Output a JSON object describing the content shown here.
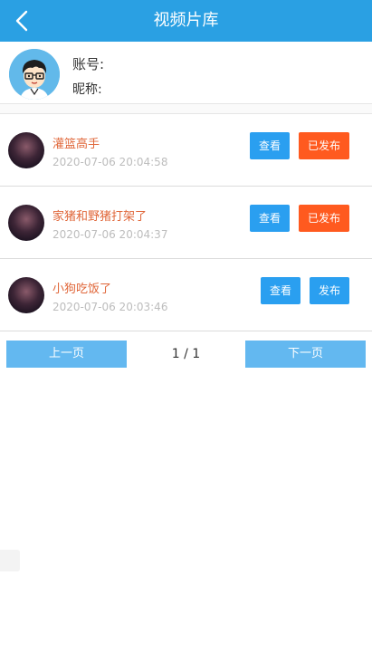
{
  "header": {
    "title": "视频片库",
    "back_icon": "chevron-left-icon"
  },
  "profile": {
    "account_label": "账号:",
    "account_value": "",
    "nickname_label": "昵称:",
    "nickname_value": ""
  },
  "videos": [
    {
      "title": "灌篮高手",
      "time": "2020-07-06 20:04:58",
      "view_label": "查看",
      "publish_label": "已发布",
      "published": true
    },
    {
      "title": "家猪和野猪打架了",
      "time": "2020-07-06 20:04:37",
      "view_label": "查看",
      "publish_label": "已发布",
      "published": true
    },
    {
      "title": "小狗吃饭了",
      "time": "2020-07-06 20:03:46",
      "view_label": "查看",
      "publish_label": "发布",
      "published": false
    }
  ],
  "pagination": {
    "prev_label": "上一页",
    "page_info": "1 / 1",
    "next_label": "下一页"
  },
  "colors": {
    "header": "#2aa0e3",
    "title_text": "#e0673a",
    "view_button": "#2a9ff0",
    "published_button": "#ff5a1f",
    "publish_button": "#2a9ff0",
    "pager_button": "#63b8f0"
  }
}
